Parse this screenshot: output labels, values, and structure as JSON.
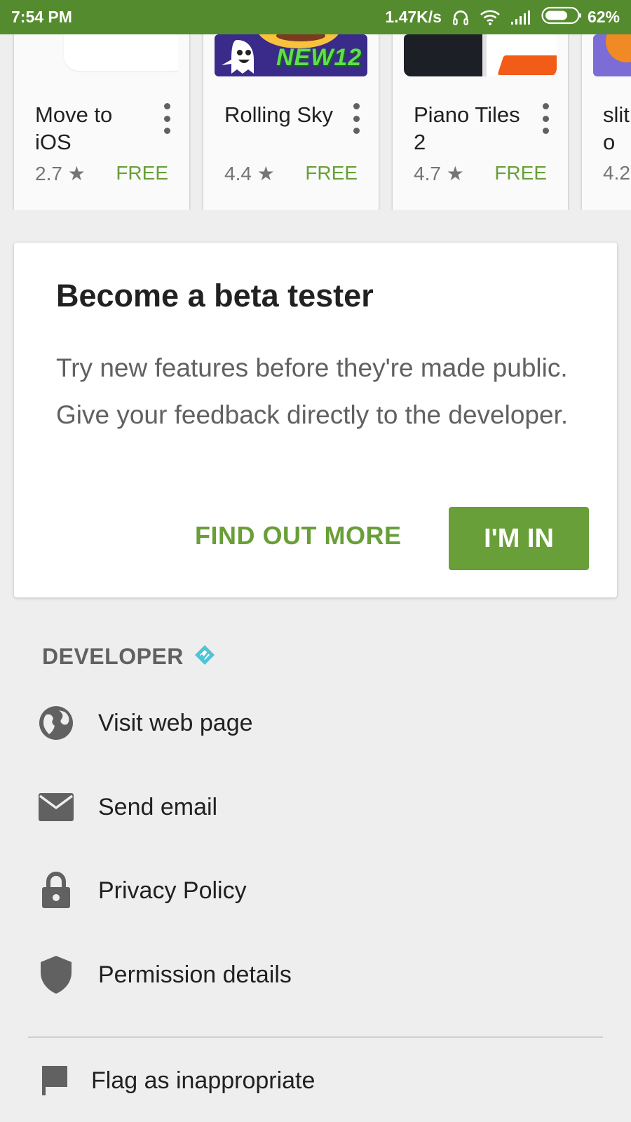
{
  "status_bar": {
    "time": "7:54 PM",
    "speed": "1.47K/s",
    "battery": "62%",
    "icons": [
      "headphones-icon",
      "wifi-icon",
      "signal-icon",
      "battery-icon"
    ]
  },
  "apps": [
    {
      "title": "Move to iOS",
      "rating": "2.7",
      "price": "FREE"
    },
    {
      "title": "Rolling Sky",
      "rating": "4.4",
      "price": "FREE",
      "thumb_text": "NEW12"
    },
    {
      "title": "Piano Tiles 2",
      "rating": "4.7",
      "price": "FREE"
    },
    {
      "title": "slit o",
      "rating": "4.2"
    }
  ],
  "beta": {
    "title": "Become a beta tester",
    "body": "Try new features before they're made public. Give your feedback directly to the developer.",
    "find_out_more": "FIND OUT MORE",
    "im_in": "I'M IN"
  },
  "developer": {
    "label": "DEVELOPER",
    "items": [
      {
        "label": "Visit web page",
        "icon": "globe-icon"
      },
      {
        "label": "Send email",
        "icon": "mail-icon"
      },
      {
        "label": "Privacy Policy",
        "icon": "lock-icon"
      },
      {
        "label": "Permission details",
        "icon": "shield-icon"
      }
    ],
    "flag": {
      "label": "Flag as inappropriate",
      "icon": "flag-icon"
    }
  },
  "colors": {
    "status_bar": "#558b2f",
    "accent": "#689f38",
    "verified": "#4fc3d7"
  }
}
